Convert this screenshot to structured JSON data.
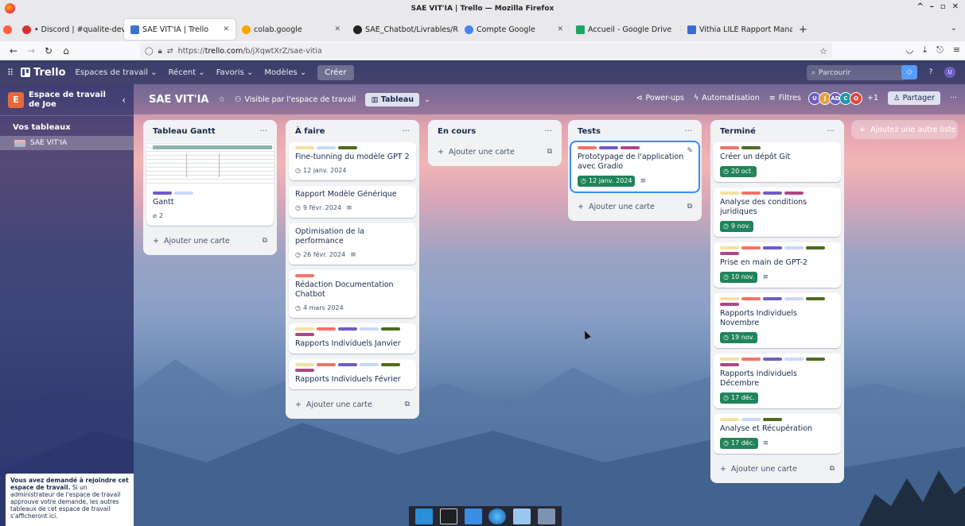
{
  "window": {
    "title": "SAE VIT'IA | Trello — Mozilla Firefox",
    "controls": [
      "^",
      "–",
      "▫",
      "✕"
    ]
  },
  "browser": {
    "tabs": [
      {
        "label": "• Discord | #qualite-dev",
        "close": "✕",
        "color": "#d9302d"
      },
      {
        "label": "SAE VIT'IA | Trello",
        "close": "✕",
        "color": "#3b74c9"
      },
      {
        "label": "colab.google",
        "close": "✕",
        "color": "#f7a600"
      },
      {
        "label": "SAE_Chatbot/Livrables/R..",
        "close": "✕",
        "color": "#222222"
      },
      {
        "label": "Compte Google",
        "close": "✕",
        "color": "#4285f4"
      },
      {
        "label": "Accueil - Google Drive",
        "close": "✕",
        "color": "#1fa463"
      },
      {
        "label": "Vithia LILE Rapport Mana",
        "close": "✕",
        "color": "#3d6bd6"
      }
    ],
    "new_tab": "+",
    "tabs_list": "⌄",
    "url_prefix": "https://",
    "url_host": "trello.com",
    "url_path": "/b/jXqwtXrZ/sae-vitia"
  },
  "trello": {
    "brand": "Trello",
    "menu": [
      "Espaces de travail ⌄",
      "Récent ⌄",
      "Favoris ⌄",
      "Modèles ⌄"
    ],
    "create": "Créer",
    "search_placeholder": "Parcourir",
    "user_initial": "U"
  },
  "sidebar": {
    "workspace_initial": "E",
    "workspace_name": "Espace de travail de Joe",
    "toggle": "‹",
    "boards_title": "Vos tableaux",
    "board": "SAE VIT'IA",
    "notice_bold": "Vous avez demandé à rejoindre cet espace de travail.",
    "notice_text": " Si un administrateur de l'espace de travail approuve votre demande, les autres tableaux de cet espace de travail s'afficheront ici."
  },
  "board": {
    "title": "SAE VIT'IA",
    "visibility": "Visible par l'espace de travail",
    "view": "Tableau",
    "powerups": "Power-ups",
    "automation": "Automatisation",
    "filters": "Filtres",
    "members": [
      {
        "initials": "U",
        "color": "#6e5dc6"
      },
      {
        "initials": "J",
        "color": "#e2a03f"
      },
      {
        "initials": "AD",
        "color": "#6e5dc6"
      },
      {
        "initials": "C",
        "color": "#1d9aaa"
      },
      {
        "initials": "O",
        "color": "#e2483d"
      }
    ],
    "members_extra": "+1",
    "share": "Partager",
    "add_list": "Ajoutez une autre liste"
  },
  "colors": {
    "green": "#4c6b1f",
    "purple": "#6e5dc6",
    "light_blue": "#c7d9f7",
    "yellow": "#f5e0a0",
    "red": "#f87168",
    "magenta": "#ae4787"
  },
  "lists": [
    {
      "title": "Tableau Gantt",
      "add_card": "Ajouter une carte",
      "cards": [
        {
          "title": "Gantt",
          "labels": [
            "purple",
            "light_blue"
          ],
          "attachments": "2",
          "cover": true
        }
      ]
    },
    {
      "title": "À faire",
      "add_card": "Ajouter une carte",
      "cards": [
        {
          "title": "Fine-tunning du modèle GPT 2",
          "labels": [
            "yellow",
            "light_blue",
            "green"
          ],
          "date": "12 janv. 2024"
        },
        {
          "title": "Rapport Modèle Générique",
          "labels": [],
          "date": "9 févr. 2024",
          "desc": true
        },
        {
          "title": "Optimisation de la performance",
          "labels": [],
          "date": "26 févr. 2024",
          "desc": true
        },
        {
          "title": "Rédaction Documentation Chatbot",
          "labels": [
            "red"
          ],
          "date": "4 mars 2024"
        },
        {
          "title": "Rapports Individuels Janvier",
          "labels": [
            "yellow",
            "red",
            "purple",
            "light_blue",
            "green",
            "magenta"
          ]
        },
        {
          "title": "Rapports Individuels Février",
          "labels": [
            "yellow",
            "red",
            "purple",
            "light_blue",
            "green",
            "magenta"
          ]
        }
      ]
    },
    {
      "title": "En cours",
      "add_card": "Ajouter une carte",
      "cards": []
    },
    {
      "title": "Tests",
      "add_card": "Ajouter une carte",
      "cards": [
        {
          "title": "Prototypage de l'application avec Gradio",
          "labels": [
            "red",
            "purple",
            "magenta"
          ],
          "date": "12 janv. 2024",
          "date_done": true,
          "desc": true,
          "focus": true
        }
      ]
    },
    {
      "title": "Terminé",
      "add_card": "Ajouter une carte",
      "cards": [
        {
          "title": "Créer un dépôt Git",
          "labels": [
            "red",
            "green"
          ],
          "date": "20 oct.",
          "date_done": true
        },
        {
          "title": "Analyse des conditions juridiques",
          "labels": [
            "yellow",
            "red",
            "purple",
            "magenta"
          ],
          "date": "9 nov.",
          "date_done": true
        },
        {
          "title": "Prise en main de GPT-2",
          "labels": [
            "yellow",
            "red",
            "purple",
            "light_blue",
            "green",
            "magenta"
          ],
          "date": "10 nov.",
          "date_done": true,
          "desc": true
        },
        {
          "title": "Rapports Individuels Novembre",
          "labels": [
            "yellow",
            "red",
            "purple",
            "light_blue",
            "green",
            "magenta"
          ],
          "date": "19 nov.",
          "date_done": true
        },
        {
          "title": "Rapports Individuels Décembre",
          "labels": [
            "yellow",
            "red",
            "purple",
            "light_blue",
            "green",
            "magenta"
          ],
          "date": "17 déc.",
          "date_done": true
        },
        {
          "title": "Analyse et Récupération",
          "labels": [
            "yellow",
            "light_blue",
            "green"
          ],
          "date": "17 déc.",
          "date_done": true,
          "desc": true
        }
      ]
    }
  ]
}
